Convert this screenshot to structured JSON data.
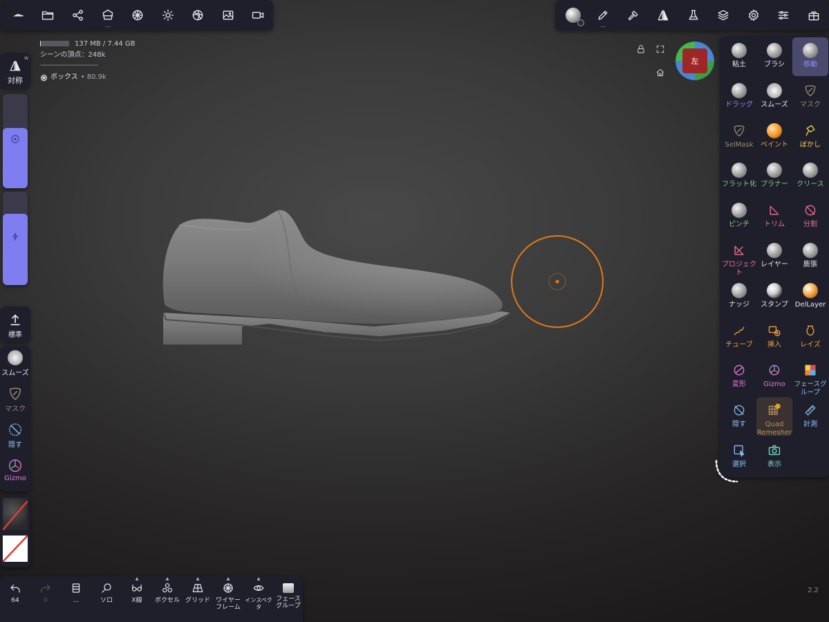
{
  "top_left_toolbar": {
    "items": [
      {
        "name": "nomad-logo-icon"
      },
      {
        "name": "folder-icon"
      },
      {
        "name": "scene-graph-icon"
      },
      {
        "name": "primitive-icon"
      },
      {
        "name": "material-sphere-icon"
      },
      {
        "name": "light-icon"
      },
      {
        "name": "shading-icon"
      },
      {
        "name": "background-image-icon"
      },
      {
        "name": "camera-icon"
      }
    ],
    "dots": "..."
  },
  "top_right_toolbar": {
    "items": [
      {
        "name": "current-tool-icon"
      },
      {
        "name": "stroke-icon"
      },
      {
        "name": "hammer-icon"
      },
      {
        "name": "symmetry-icon"
      },
      {
        "name": "flask-icon"
      },
      {
        "name": "layers-icon"
      },
      {
        "name": "settings-icon"
      },
      {
        "name": "sliders-icon"
      },
      {
        "name": "scene-icon"
      }
    ],
    "dots": "..."
  },
  "info": {
    "memory": "137 MB / 7.44 GB",
    "memory_fraction": 0.02,
    "vertices": "シーンの頂点：248k",
    "separator": "--------------------------------",
    "object_name": "ボックス",
    "object_verts": " • 80.9k"
  },
  "orientation_cube": {
    "face_label": "左",
    "face_color": "#9e2626"
  },
  "left_panel": {
    "symmetry_label": "対称",
    "symmetry_badge": "W",
    "radius_slider_value": 0.64,
    "intensity_slider_value": 0.76,
    "standard_label": "標準",
    "smooth_label": "スムーズ",
    "mask_label": "マスク",
    "hide_label": "隠す",
    "gizmo_label": "Gizmo"
  },
  "tools": [
    {
      "label": "粘土",
      "color": "#e8e8f0"
    },
    {
      "label": "ブラシ",
      "color": "#e8e8f0"
    },
    {
      "label": "移動",
      "color": "#8e8cf5"
    },
    {
      "label": "ドラッグ",
      "color": "#8e8cf5"
    },
    {
      "label": "スムーズ",
      "color": "#e8e8f0"
    },
    {
      "label": "マスク",
      "color": "#9a8a72"
    },
    {
      "label": "SelMask",
      "color": "#9a8a72"
    },
    {
      "label": "ペイント",
      "color": "#f0a030"
    },
    {
      "label": "ぼかし",
      "color": "#f0d24a"
    },
    {
      "label": "フラット化",
      "color": "#7ed07e"
    },
    {
      "label": "プラナー",
      "color": "#7ed07e"
    },
    {
      "label": "クリース",
      "color": "#7ed07e"
    },
    {
      "label": "ピンチ",
      "color": "#7ed07e"
    },
    {
      "label": "トリム",
      "color": "#f07090"
    },
    {
      "label": "分割",
      "color": "#f07090"
    },
    {
      "label": "プロジェクト",
      "color": "#f07090"
    },
    {
      "label": "レイヤー",
      "color": "#e8e8f0"
    },
    {
      "label": "膨張",
      "color": "#e8e8f0"
    },
    {
      "label": "ナッジ",
      "color": "#e8e8f0"
    },
    {
      "label": "スタンプ",
      "color": "#e8e8f0"
    },
    {
      "label": "DelLayer",
      "color": "#e8e8f0"
    },
    {
      "label": "チューブ",
      "color": "#f0a030"
    },
    {
      "label": "挿入",
      "color": "#f0a030"
    },
    {
      "label": "レイズ",
      "color": "#f0a030"
    },
    {
      "label": "変形",
      "color": "#e07ad8"
    },
    {
      "label": "Gizmo",
      "color": "#e07ad8"
    },
    {
      "label": "フェースグループ",
      "color": "#8cc2f0"
    },
    {
      "label": "隠す",
      "color": "#8cc2f0"
    },
    {
      "label": "Quad Remesher",
      "color": "#b0905a"
    },
    {
      "label": "計測",
      "color": "#8cc2f0"
    },
    {
      "label": "選択",
      "color": "#8cc2f0"
    },
    {
      "label": "表示",
      "color": "#72e0c8"
    }
  ],
  "bottom_bar": {
    "undo_count": "64",
    "redo_count": "0",
    "more_label": "...",
    "solo_label": "ソロ",
    "xray_label": "X線",
    "voxel_label": "ボクセル",
    "grid_label": "グリッド",
    "wireframe_label": "ワイヤーフレーム",
    "inspector_label": "インスペクタ",
    "facegroup_label": "フェースグループ"
  },
  "version": "2.2",
  "colors": {
    "accent": "#7f7ef0",
    "panel": "#1f1f2c",
    "cursor": "#e27a16"
  }
}
